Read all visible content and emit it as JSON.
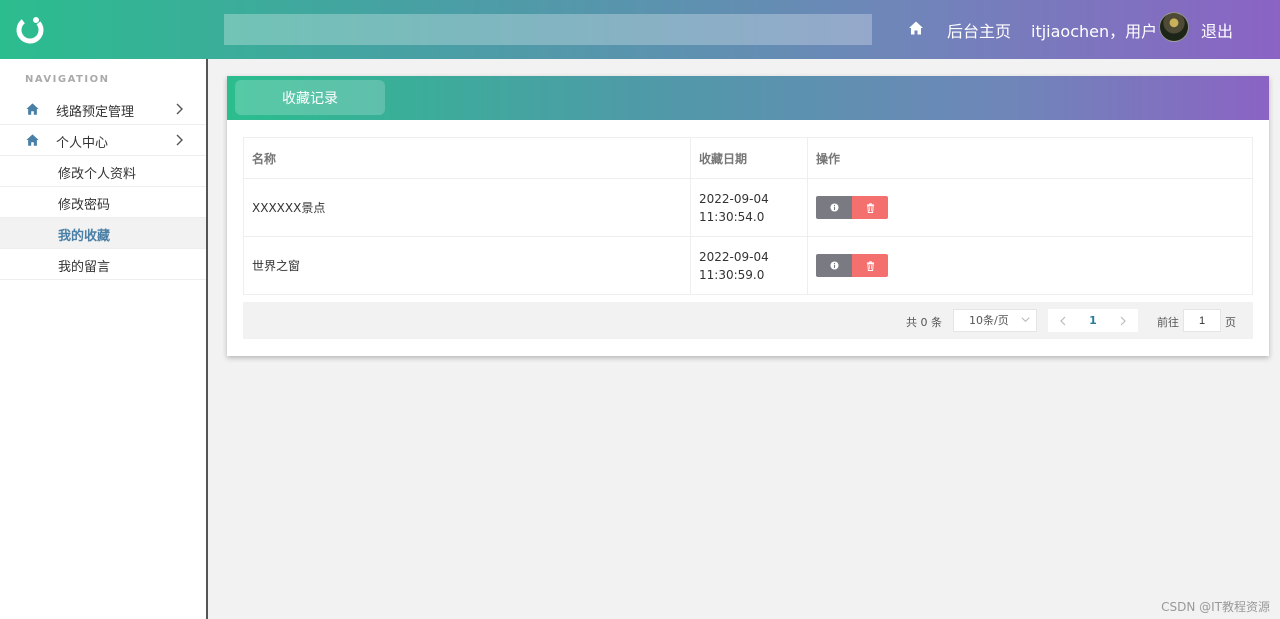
{
  "header": {
    "search_placeholder": "",
    "nav_home": "后台主页",
    "user_label": "itjiaochen，用户",
    "logout": "退出"
  },
  "sidebar": {
    "caption": "NAVIGATION",
    "items": [
      {
        "label": "线路预定管理",
        "icon": "home-icon",
        "expandable": true
      },
      {
        "label": "个人中心",
        "icon": "home-icon",
        "expandable": true
      }
    ],
    "sub_items": [
      {
        "label": "修改个人资料",
        "active": false
      },
      {
        "label": "修改密码",
        "active": false
      },
      {
        "label": "我的收藏",
        "active": true
      },
      {
        "label": "我的留言",
        "active": false
      }
    ]
  },
  "main": {
    "tab": "收藏记录",
    "table": {
      "headers": [
        "名称",
        "收藏日期",
        "操作"
      ],
      "rows": [
        {
          "name": "XXXXXX景点",
          "date": "2022-09-04 11:30:54.0"
        },
        {
          "name": "世界之窗",
          "date": "2022-09-04 11:30:59.0"
        }
      ]
    },
    "pagination": {
      "total": "共 0 条",
      "page_size": "10条/页",
      "current_page": "1",
      "goto_prefix": "前往",
      "goto_value": "1",
      "goto_suffix": "页"
    }
  },
  "colors": {
    "header_start": "#2bbd8e",
    "header_end": "#8b63c4",
    "info_button": "#7a7a82",
    "delete_button": "#f4706f",
    "active_link": "#4a7fa6"
  },
  "watermark": "CSDN @IT教程资源"
}
